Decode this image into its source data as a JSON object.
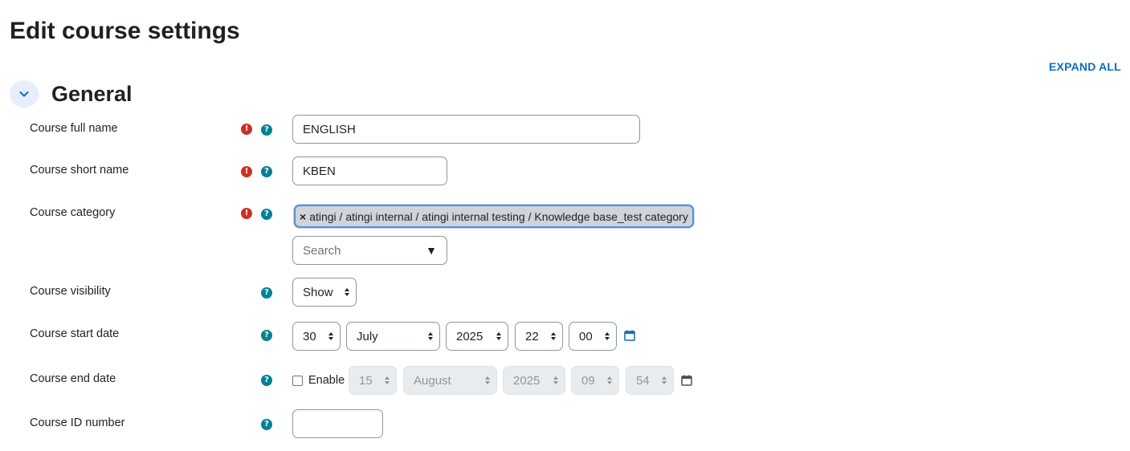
{
  "page": {
    "title": "Edit course settings",
    "expand_all": "EXPAND ALL"
  },
  "section": {
    "title": "General"
  },
  "fields": {
    "full_name": {
      "label": "Course full name",
      "value": "ENGLISH"
    },
    "short_name": {
      "label": "Course short name",
      "value": "KBEN"
    },
    "category": {
      "label": "Course category",
      "chip_remove": "×",
      "chip_text": "atingi / atingi internal / atingi internal testing / Knowledge base_test category",
      "search_placeholder": "Search",
      "dropdown_glyph": "▼"
    },
    "visibility": {
      "label": "Course visibility",
      "value": "Show"
    },
    "start_date": {
      "label": "Course start date",
      "day": "30",
      "month": "July",
      "year": "2025",
      "hour": "22",
      "minute": "00"
    },
    "end_date": {
      "label": "Course end date",
      "enable_label": "Enable",
      "enabled": false,
      "day": "15",
      "month": "August",
      "year": "2025",
      "hour": "09",
      "minute": "54"
    },
    "id_number": {
      "label": "Course ID number",
      "value": ""
    }
  },
  "icons": {
    "required": "!",
    "help": "?"
  },
  "colors": {
    "accent": "#0f6cbf",
    "required": "#ca3120",
    "help": "#008196"
  }
}
